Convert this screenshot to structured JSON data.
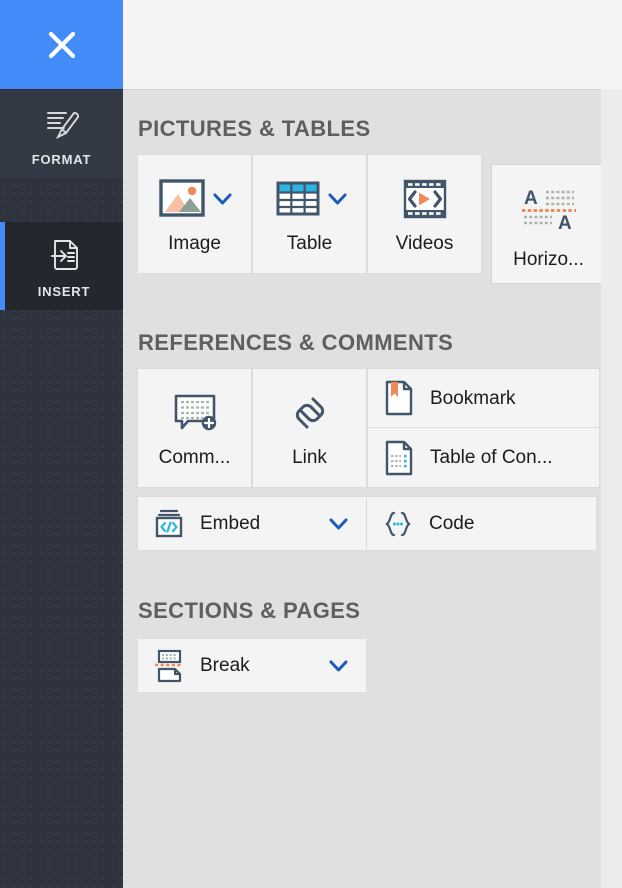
{
  "rail": {
    "close": {
      "name": "close-panel",
      "icon": "close-icon",
      "color": "#428bf9"
    },
    "items": [
      {
        "label": "FORMAT",
        "icon": "paintbrush-icon",
        "selected": false
      },
      {
        "label": "INSERT",
        "icon": "insert-document-icon",
        "selected": true
      }
    ]
  },
  "sections": [
    {
      "title": "PICTURES & TABLES",
      "tiles": [
        {
          "label": "Image",
          "icon": "image-icon",
          "dropdown": true
        },
        {
          "label": "Table",
          "icon": "table-icon",
          "dropdown": true
        },
        {
          "label": "Videos",
          "icon": "video-icon",
          "dropdown": false
        },
        {
          "label": "Horizo...",
          "icon": "horizontal-line-icon",
          "dropdown": false
        }
      ]
    },
    {
      "title": "REFERENCES & COMMENTS",
      "tiles": [
        {
          "label": "Comm...",
          "icon": "comment-add-icon",
          "dropdown": false
        },
        {
          "label": "Link",
          "icon": "link-icon",
          "dropdown": false
        },
        {
          "label": "Bookmark",
          "icon": "bookmark-icon",
          "dropdown": false
        },
        {
          "label": "Table of Con...",
          "icon": "table-of-contents-icon",
          "dropdown": false
        },
        {
          "label": "Embed",
          "icon": "embed-code-icon",
          "dropdown": true
        },
        {
          "label": "Code",
          "icon": "code-braces-icon",
          "dropdown": false
        }
      ]
    },
    {
      "title": "SECTIONS & PAGES",
      "tiles": [
        {
          "label": "Break",
          "icon": "page-break-icon",
          "dropdown": true
        }
      ]
    }
  ],
  "colors": {
    "accent_blue": "#428bf9",
    "slate": "#41566b",
    "orange": "#f08a5d",
    "cyan": "#2cb5e0",
    "rail_bg": "#2e333d",
    "panel_bg": "#e0e0e0",
    "tile_bg": "#f4f4f4"
  }
}
